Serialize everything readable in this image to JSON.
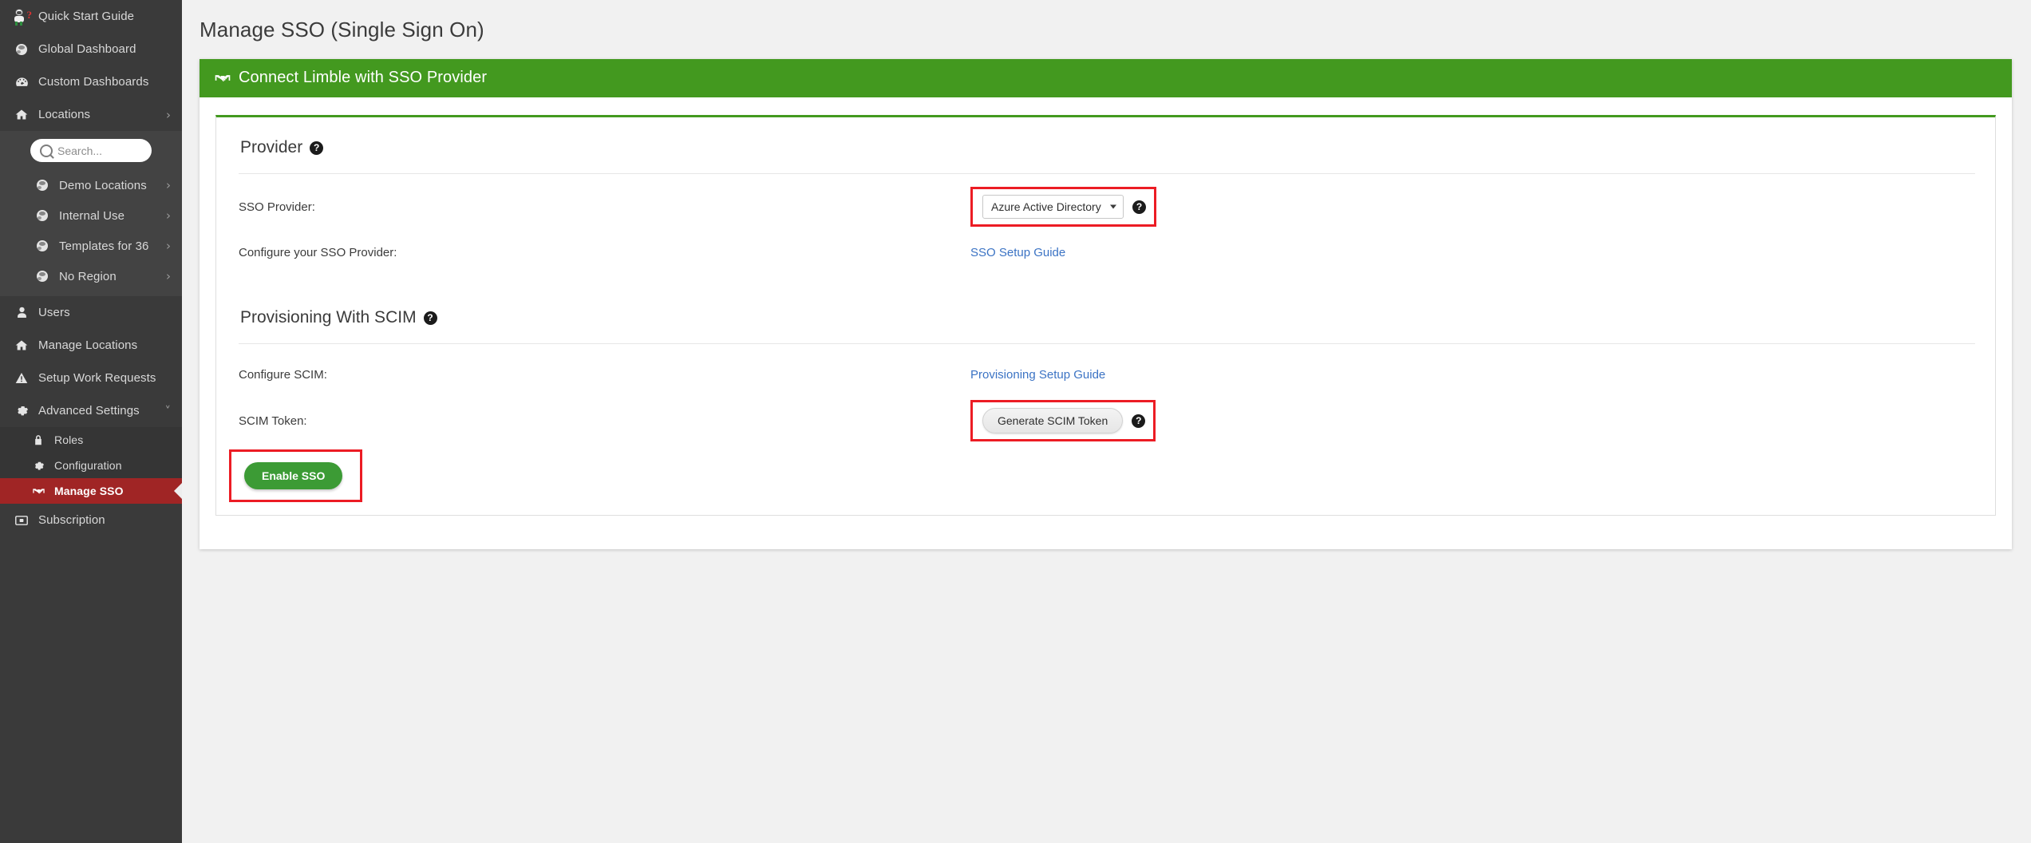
{
  "sidebar": {
    "search": {
      "placeholder": "Search..."
    },
    "items": [
      {
        "label": "Quick Start Guide",
        "icon": "astronaut-icon",
        "chevron": ""
      },
      {
        "label": "Global Dashboard",
        "icon": "globe-icon",
        "chevron": ""
      },
      {
        "label": "Custom Dashboards",
        "icon": "gauge-icon",
        "chevron": ""
      },
      {
        "label": "Locations",
        "icon": "home-icon",
        "chevron": "›"
      }
    ],
    "location_children": [
      {
        "label": "Demo Locations",
        "icon": "globe-icon",
        "chevron": "›"
      },
      {
        "label": "Internal Use",
        "icon": "globe-icon",
        "chevron": "›"
      },
      {
        "label": "Templates for 36",
        "icon": "globe-icon",
        "chevron": "›"
      },
      {
        "label": "No Region",
        "icon": "globe-icon",
        "chevron": "›"
      }
    ],
    "items_lower": [
      {
        "label": "Users",
        "icon": "user-icon",
        "chevron": ""
      },
      {
        "label": "Manage Locations",
        "icon": "home-icon",
        "chevron": ""
      },
      {
        "label": "Setup Work Requests",
        "icon": "warning-triangle-icon",
        "chevron": ""
      },
      {
        "label": "Advanced Settings",
        "icon": "gear-icon",
        "chevron": "˅"
      }
    ],
    "advanced_children": [
      {
        "label": "Roles",
        "icon": "lock-icon",
        "active": false
      },
      {
        "label": "Configuration",
        "icon": "gear-icon",
        "active": false
      },
      {
        "label": "Manage SSO",
        "icon": "handshake-icon",
        "active": true
      }
    ],
    "items_last": [
      {
        "label": "Subscription",
        "icon": "card-icon",
        "chevron": ""
      }
    ]
  },
  "page": {
    "title": "Manage SSO (Single Sign On)",
    "card_header": "Connect Limble with SSO Provider"
  },
  "provider": {
    "section_title": "Provider",
    "sso_provider_label": "SSO Provider:",
    "sso_provider_value": "Azure Active Directory",
    "sso_provider_options": [
      "Azure Active Directory"
    ],
    "configure_label": "Configure your SSO Provider:",
    "setup_guide_link": "SSO Setup Guide"
  },
  "scim": {
    "section_title": "Provisioning With SCIM",
    "configure_label": "Configure SCIM:",
    "provisioning_guide_link": "Provisioning Setup Guide",
    "token_label": "SCIM Token:",
    "generate_button": "Generate SCIM Token"
  },
  "footer": {
    "enable_sso_button": "Enable SSO"
  },
  "colors": {
    "brand_green": "#43991f",
    "button_green": "#3c9b35",
    "highlight_red": "#ec1c24",
    "active_nav_red": "#a02525",
    "link_blue": "#3b73c4",
    "sidebar_bg": "#3a3a3a",
    "page_bg": "#f1f1f1"
  },
  "icons": {
    "help": "?",
    "search": "search-icon"
  }
}
